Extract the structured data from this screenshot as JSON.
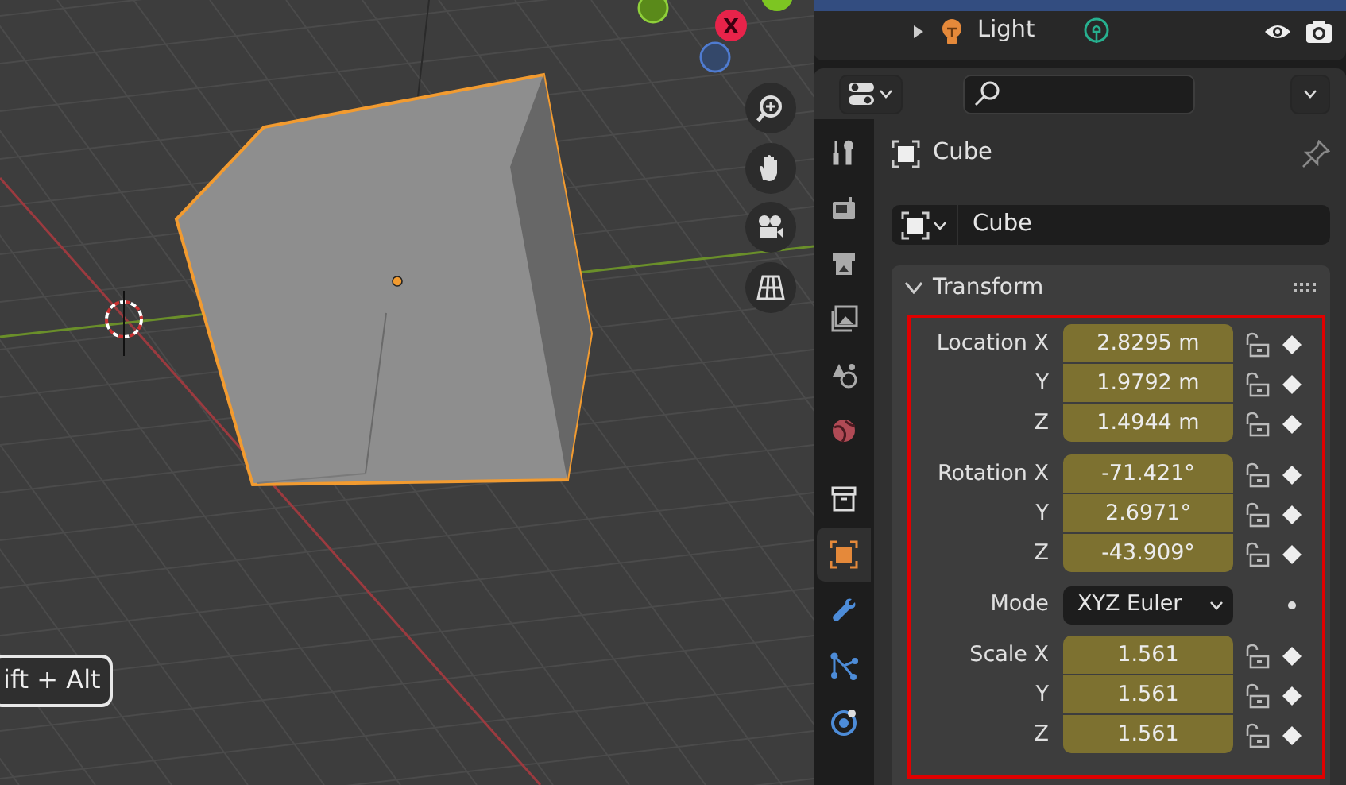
{
  "viewport": {
    "gizmo_axis": "X",
    "key_overlay": "ift + Alt",
    "nav_buttons": [
      {
        "kind": "zoom"
      },
      {
        "kind": "pan"
      },
      {
        "kind": "camera"
      },
      {
        "kind": "grid"
      }
    ]
  },
  "outliner": {
    "rows": [
      {
        "label": "Light",
        "expanded": false,
        "selected": false
      }
    ]
  },
  "properties": {
    "tabs": [
      {
        "kind": "tool",
        "selected": false
      },
      {
        "kind": "render",
        "selected": false
      },
      {
        "kind": "output",
        "selected": false
      },
      {
        "kind": "view",
        "selected": false
      },
      {
        "kind": "scene",
        "selected": false
      },
      {
        "kind": "world",
        "selected": false
      },
      {
        "kind": "collection",
        "selected": false
      },
      {
        "kind": "object",
        "selected": true
      },
      {
        "kind": "modifier",
        "selected": false
      },
      {
        "kind": "particles",
        "selected": false
      },
      {
        "kind": "physics",
        "selected": false
      }
    ],
    "object_name": "Cube",
    "datablock": "Cube",
    "panel": {
      "title": "Transform",
      "expanded": true,
      "groups": [
        {
          "rows": [
            {
              "kind": "number",
              "label": "Location X",
              "value": "2.8295 m"
            },
            {
              "kind": "number",
              "label": "Y",
              "value": "1.9792 m"
            },
            {
              "kind": "number",
              "label": "Z",
              "value": "1.4944 m"
            }
          ]
        },
        {
          "rows": [
            {
              "kind": "number",
              "label": "Rotation X",
              "value": "-71.421°"
            },
            {
              "kind": "number",
              "label": "Y",
              "value": "2.6971°"
            },
            {
              "kind": "number",
              "label": "Z",
              "value": "-43.909°"
            }
          ]
        },
        {
          "rows": [
            {
              "kind": "dropdown",
              "label": "Mode",
              "value": "XYZ Euler"
            }
          ]
        },
        {
          "rows": [
            {
              "kind": "number",
              "label": "Scale X",
              "value": "1.561"
            },
            {
              "kind": "number",
              "label": "Y",
              "value": "1.561"
            },
            {
              "kind": "number",
              "label": "Z",
              "value": "1.561"
            }
          ]
        }
      ]
    }
  }
}
